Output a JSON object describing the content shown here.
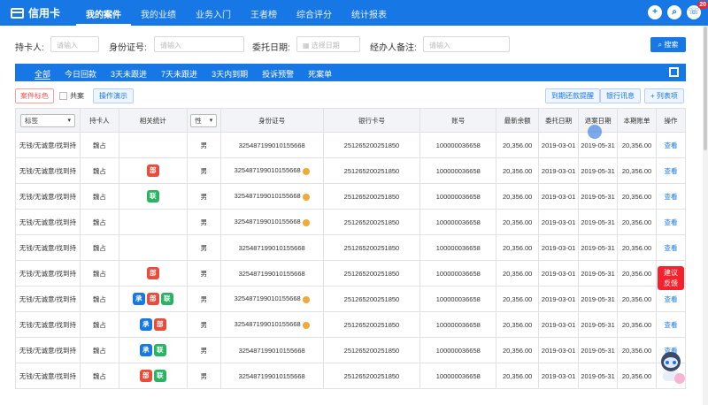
{
  "app": {
    "title": "信用卡"
  },
  "nav": [
    "我的案件",
    "我的业绩",
    "业务入门",
    "王者榜",
    "综合评分",
    "统计报表"
  ],
  "top_badge": "20",
  "search": {
    "cardholder_label": "持卡人:",
    "cardholder_placeholder": "请输入",
    "id_label": "身份证号:",
    "id_placeholder": "请输入",
    "date_label": "委托日期:",
    "date_placeholder": "选择日期",
    "remark_label": "经办人备注:",
    "remark_placeholder": "请输入",
    "search_btn": "搜索"
  },
  "tabs": [
    "全部",
    "今日回款",
    "3天未跟进",
    "7天未跟进",
    "3天内到期",
    "投诉预警",
    "死案单"
  ],
  "tools": {
    "tag": "案件标色",
    "shared": "共案",
    "demo": "操作演示",
    "remind": "到期还款提醒",
    "bank_info": "银行讯息",
    "columns": "+ 列表项"
  },
  "table": {
    "headers": {
      "tag": "标签",
      "holder": "持卡人",
      "stats": "相关统计",
      "gender": "性",
      "id": "身份证号",
      "card": "银行卡号",
      "account": "账号",
      "balance": "最新余额",
      "entrust": "委托日期",
      "return": "退案日期",
      "bill": "本期账单",
      "action": "操作"
    },
    "rows": [
      {
        "tag": "无钱/无诚意/找到持",
        "holder": "魏占",
        "pills": [],
        "gender": "男",
        "id": "325487199010155668",
        "dot": "",
        "card": "251265200251850",
        "account": "100000036658",
        "balance": "20,356.00",
        "entrust": "2019-03-01",
        "return": "2019-05-31",
        "bill": "20,356.00",
        "action": "查看"
      },
      {
        "tag": "无钱/无诚意/找到持",
        "holder": "魏占",
        "pills": [
          {
            "t": "部",
            "c": "p-red"
          }
        ],
        "gender": "男",
        "id": "325487199010155668",
        "dot": "1",
        "card": "251265200251850",
        "account": "100000036658",
        "balance": "20,356.00",
        "entrust": "2019-03-01",
        "return": "2019-05-31",
        "bill": "20,356.00",
        "action": "查看"
      },
      {
        "tag": "无钱/无诚意/找到持",
        "holder": "魏占",
        "pills": [
          {
            "t": "联",
            "c": "p-green"
          }
        ],
        "gender": "男",
        "id": "325487199010155668",
        "dot": "4",
        "card": "251265200251850",
        "account": "100000036658",
        "balance": "20,356.00",
        "entrust": "2019-03-01",
        "return": "2019-05-31",
        "bill": "20,356.00",
        "action": "查看"
      },
      {
        "tag": "无钱/无诚意/找到持",
        "holder": "魏占",
        "pills": [],
        "gender": "男",
        "id": "325487199010155668",
        "dot": "2",
        "card": "251265200251850",
        "account": "100000036658",
        "balance": "20,356.00",
        "entrust": "2019-03-01",
        "return": "2019-05-31",
        "bill": "20,356.00",
        "action": "查看"
      },
      {
        "tag": "无钱/无诚意/找到持",
        "holder": "魏占",
        "pills": [],
        "gender": "男",
        "id": "325487199010155668",
        "dot": "",
        "card": "251265200251850",
        "account": "100000036658",
        "balance": "20,356.00",
        "entrust": "2019-03-01",
        "return": "2019-05-31",
        "bill": "20,356.00",
        "action": "查看"
      },
      {
        "tag": "无钱/无诚意/找到持",
        "holder": "魏占",
        "pills": [
          {
            "t": "部",
            "c": "p-red"
          }
        ],
        "gender": "男",
        "id": "325487199010155668",
        "dot": "",
        "card": "251265200251850",
        "account": "100000036658",
        "balance": "20,356.00",
        "entrust": "2019-03-01",
        "return": "2019-05-31",
        "bill": "20,356.00",
        "action": "查看"
      },
      {
        "tag": "无钱/无诚意/找到持",
        "holder": "魏占",
        "pills": [
          {
            "t": "承",
            "c": "p-blue"
          },
          {
            "t": "部",
            "c": "p-red"
          },
          {
            "t": "联",
            "c": "p-green"
          }
        ],
        "gender": "男",
        "id": "325487199010155668",
        "dot": "1",
        "card": "251265200251850",
        "account": "100000036658",
        "balance": "20,356.00",
        "entrust": "2019-03-01",
        "return": "2019-05-31",
        "bill": "20,356.00",
        "action": "查看"
      },
      {
        "tag": "无钱/无诚意/找到持",
        "holder": "魏占",
        "pills": [
          {
            "t": "承",
            "c": "p-blue"
          },
          {
            "t": "部",
            "c": "p-red"
          }
        ],
        "gender": "男",
        "id": "325487199010155668",
        "dot": "1",
        "card": "251265200251850",
        "account": "100000036658",
        "balance": "20,356.00",
        "entrust": "2019-03-01",
        "return": "2019-05-31",
        "bill": "20,356.00",
        "action": "查看"
      },
      {
        "tag": "无钱/无诚意/找到持",
        "holder": "魏占",
        "pills": [
          {
            "t": "承",
            "c": "p-blue"
          },
          {
            "t": "联",
            "c": "p-green"
          }
        ],
        "gender": "男",
        "id": "325487199010155668",
        "dot": "",
        "card": "251265200251850",
        "account": "100000036658",
        "balance": "20,356.00",
        "entrust": "2019-03-01",
        "return": "2019-05-31",
        "bill": "20,356.00",
        "action": "查看"
      },
      {
        "tag": "无钱/无诚意/找到持",
        "holder": "魏占",
        "pills": [
          {
            "t": "部",
            "c": "p-red"
          },
          {
            "t": "联",
            "c": "p-green"
          }
        ],
        "gender": "男",
        "id": "325487199010155668",
        "dot": "",
        "card": "251265200251850",
        "account": "100000036658",
        "balance": "20,356.00",
        "entrust": "2019-03-01",
        "return": "2019-05-31",
        "bill": "20,356.00",
        "action": "查看"
      }
    ]
  },
  "feedback": {
    "line1": "建议",
    "line2": "反馈"
  }
}
